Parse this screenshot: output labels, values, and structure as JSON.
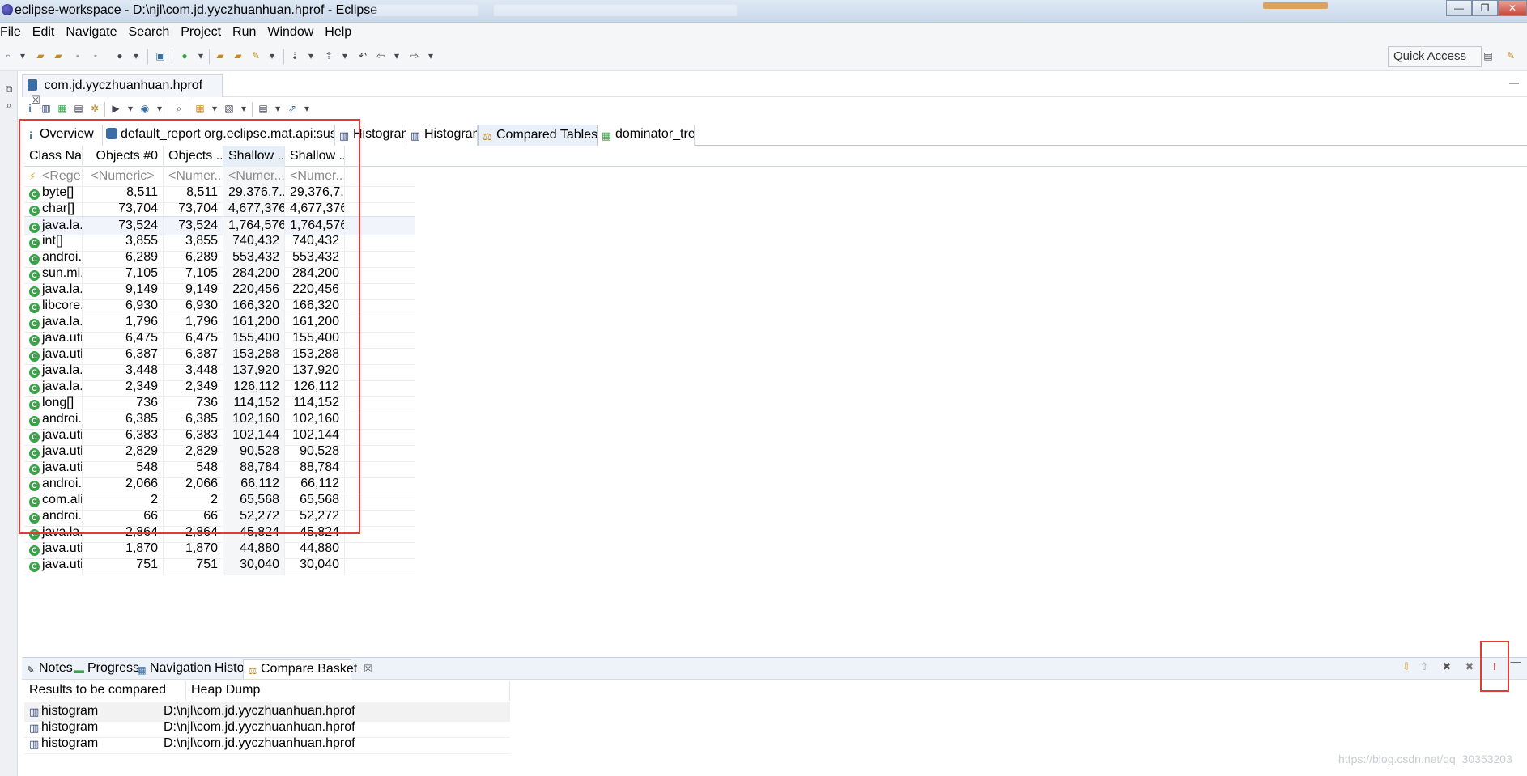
{
  "window": {
    "title": "eclipse-workspace - D:\\njl\\com.jd.yyczhuanhuan.hprof - Eclipse",
    "minimize": "—",
    "maximize": "❐",
    "close": "✕"
  },
  "menu": [
    "File",
    "Edit",
    "Navigate",
    "Search",
    "Project",
    "Run",
    "Window",
    "Help"
  ],
  "quick_access": "Quick Access",
  "editor": {
    "tab_title": "com.jd.yyczhuanhuan.hprof",
    "tab_close": "☒",
    "subtabs": [
      {
        "label": "Overview",
        "icon": "info-icon"
      },
      {
        "label": "default_report  org.eclipse.mat.api:suspects",
        "icon": "report-icon"
      },
      {
        "label": "Histogram",
        "icon": "histogram-icon"
      },
      {
        "label": "Histogram",
        "icon": "histogram-icon"
      },
      {
        "label": "Compared Tables",
        "icon": "compare-icon",
        "close": "☒"
      },
      {
        "label": "dominator_tree",
        "icon": "tree-icon"
      }
    ]
  },
  "table": {
    "columns": [
      "Class Na...",
      "Objects #0",
      "Objects ...",
      "Shallow ...",
      "Shallow ..."
    ],
    "filters": [
      "<Rege...",
      "<Numeric>",
      "<Numer...",
      "<Numer...",
      "<Numer..."
    ],
    "rows": [
      [
        "byte[]",
        "8,511",
        "8,511",
        "29,376,7...",
        "29,376,7..."
      ],
      [
        "char[]",
        "73,704",
        "73,704",
        "4,677,376",
        "4,677,376"
      ],
      [
        "java.la...",
        "73,524",
        "73,524",
        "1,764,576",
        "1,764,576"
      ],
      [
        "int[]",
        "3,855",
        "3,855",
        "740,432",
        "740,432"
      ],
      [
        "androi...",
        "6,289",
        "6,289",
        "553,432",
        "553,432"
      ],
      [
        "sun.mi...",
        "7,105",
        "7,105",
        "284,200",
        "284,200"
      ],
      [
        "java.la...",
        "9,149",
        "9,149",
        "220,456",
        "220,456"
      ],
      [
        "libcore...",
        "6,930",
        "6,930",
        "166,320",
        "166,320"
      ],
      [
        "java.la...",
        "1,796",
        "1,796",
        "161,200",
        "161,200"
      ],
      [
        "java.uti...",
        "6,475",
        "6,475",
        "155,400",
        "155,400"
      ],
      [
        "java.uti...",
        "6,387",
        "6,387",
        "153,288",
        "153,288"
      ],
      [
        "java.la...",
        "3,448",
        "3,448",
        "137,920",
        "137,920"
      ],
      [
        "java.la...",
        "2,349",
        "2,349",
        "126,112",
        "126,112"
      ],
      [
        "long[]",
        "736",
        "736",
        "114,152",
        "114,152"
      ],
      [
        "androi...",
        "6,385",
        "6,385",
        "102,160",
        "102,160"
      ],
      [
        "java.uti...",
        "6,383",
        "6,383",
        "102,144",
        "102,144"
      ],
      [
        "java.uti...",
        "2,829",
        "2,829",
        "90,528",
        "90,528"
      ],
      [
        "java.uti...",
        "548",
        "548",
        "88,784",
        "88,784"
      ],
      [
        "androi...",
        "2,066",
        "2,066",
        "66,112",
        "66,112"
      ],
      [
        "com.ali...",
        "2",
        "2",
        "65,568",
        "65,568"
      ],
      [
        "androi...",
        "66",
        "66",
        "52,272",
        "52,272"
      ],
      [
        "java.la...",
        "2,864",
        "2,864",
        "45,824",
        "45,824"
      ],
      [
        "java.uti...",
        "1,870",
        "1,870",
        "44,880",
        "44,880"
      ],
      [
        "java.uti...",
        "751",
        "751",
        "30,040",
        "30,040"
      ]
    ],
    "selected_row": 2
  },
  "bottom_panel": {
    "tabs": [
      {
        "label": "Notes",
        "icon": "notes-icon"
      },
      {
        "label": "Progress",
        "icon": "progress-icon"
      },
      {
        "label": "Navigation History",
        "icon": "navigation-history-icon"
      },
      {
        "label": "Compare Basket",
        "icon": "compare-basket-icon",
        "close": "☒"
      }
    ],
    "columns": [
      "Results to be compared",
      "Heap Dump"
    ],
    "rows": [
      [
        "histogram",
        "D:\\njl\\com.jd.yyczhuanhuan.hprof"
      ],
      [
        "histogram",
        "D:\\njl\\com.jd.yyczhuanhuan.hprof"
      ],
      [
        "histogram",
        "D:\\njl\\com.jd.yyczhuanhuan.hprof"
      ]
    ],
    "actions": {
      "move_down": "⇩",
      "move_up": "⇧",
      "remove": "✖",
      "remove_all": "✖",
      "compare": "!",
      "minimize": "—"
    }
  },
  "watermark": "https://blog.csdn.net/qq_30353203",
  "colors": {
    "highlight": "#e53935",
    "class_icon": "#3aa34a"
  }
}
